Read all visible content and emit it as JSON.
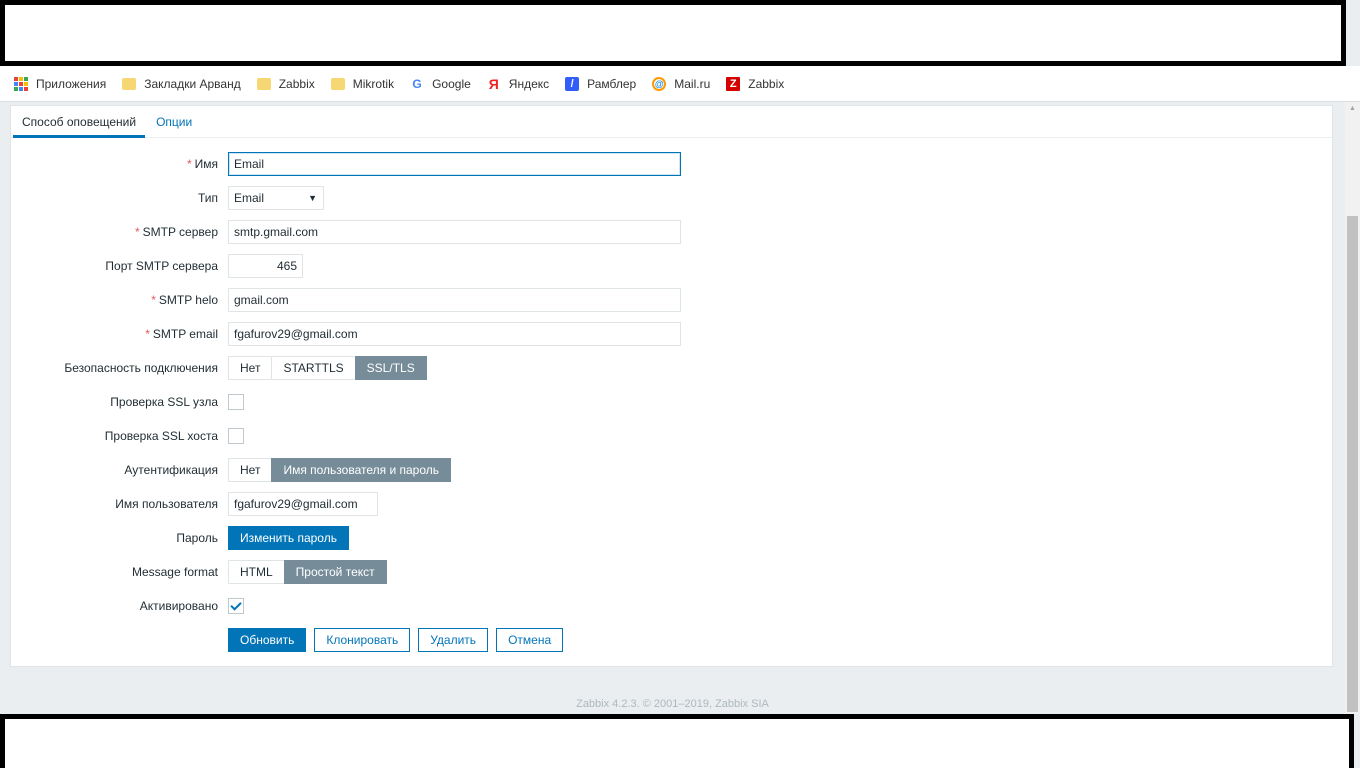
{
  "bookmarks": [
    {
      "label": "Приложения",
      "icon": "apps-icon"
    },
    {
      "label": "Закладки Арванд",
      "icon": "folder-icon"
    },
    {
      "label": "Zabbix",
      "icon": "folder-icon"
    },
    {
      "label": "Mikrotik",
      "icon": "folder-icon"
    },
    {
      "label": "Google",
      "icon": "google-icon"
    },
    {
      "label": "Яндекс",
      "icon": "yandex-icon"
    },
    {
      "label": "Рамблер",
      "icon": "rambler-icon"
    },
    {
      "label": "Mail.ru",
      "icon": "mailru-icon"
    },
    {
      "label": "Zabbix",
      "icon": "zabbix-icon"
    }
  ],
  "tabs": [
    {
      "label": "Способ оповещений",
      "active": true
    },
    {
      "label": "Опции",
      "active": false
    }
  ],
  "form": {
    "name_label": "Имя",
    "name_value": "Email",
    "type_label": "Тип",
    "type_value": "Email",
    "smtp_server_label": "SMTP сервер",
    "smtp_server_value": "smtp.gmail.com",
    "smtp_port_label": "Порт SMTP сервера",
    "smtp_port_value": "465",
    "smtp_helo_label": "SMTP helo",
    "smtp_helo_value": "gmail.com",
    "smtp_email_label": "SMTP email",
    "smtp_email_value": "fgafurov29@gmail.com",
    "security_label": "Безопасность подключения",
    "security_options": [
      "Нет",
      "STARTTLS",
      "SSL/TLS"
    ],
    "security_selected": "SSL/TLS",
    "ssl_peer_label": "Проверка SSL узла",
    "ssl_host_label": "Проверка SSL хоста",
    "auth_label": "Аутентификация",
    "auth_options": [
      "Нет",
      "Имя пользователя и пароль"
    ],
    "auth_selected": "Имя пользователя и пароль",
    "username_label": "Имя пользователя",
    "username_value": "fgafurov29@gmail.com",
    "password_label": "Пароль",
    "change_password_button": "Изменить пароль",
    "message_format_label": "Message format",
    "message_format_options": [
      "HTML",
      "Простой текст"
    ],
    "message_format_selected": "Простой текст",
    "enabled_label": "Активировано",
    "enabled": true
  },
  "actions": {
    "update": "Обновить",
    "clone": "Клонировать",
    "delete": "Удалить",
    "cancel": "Отмена"
  },
  "footer": "Zabbix 4.2.3. © 2001–2019, Zabbix SIA",
  "colors": {
    "accent": "#0275b8",
    "segment_active": "#768d99",
    "required": "#e45959"
  }
}
